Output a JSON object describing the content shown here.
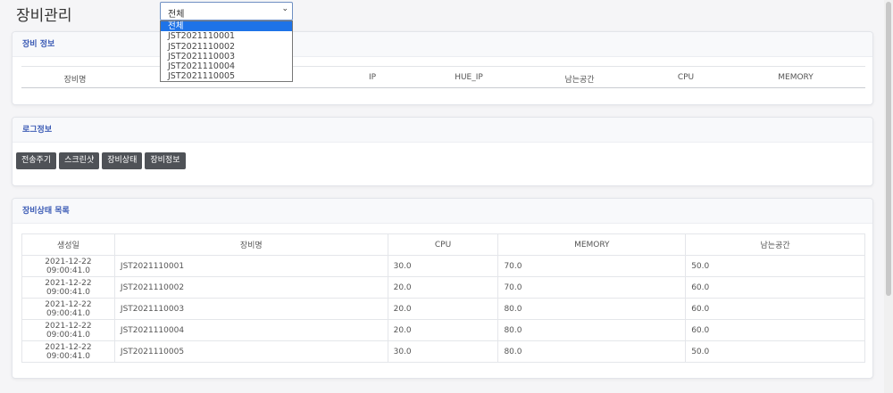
{
  "page": {
    "title": "장비관리"
  },
  "device_select": {
    "selected": "전체",
    "options": [
      "전체",
      "JST2021110001",
      "JST2021110002",
      "JST2021110003",
      "JST2021110004",
      "JST2021110005"
    ]
  },
  "device_info": {
    "title": "장비 정보",
    "columns": [
      "장비명",
      "IP",
      "HUE_IP",
      "남는공간",
      "CPU",
      "MEMORY"
    ]
  },
  "log_info": {
    "title": "로그정보",
    "buttons": [
      "전송주기",
      "스크린샷",
      "장비상태",
      "장비정보"
    ]
  },
  "status_list": {
    "title": "장비상태 목록",
    "columns": [
      "생성일",
      "장비명",
      "CPU",
      "MEMORY",
      "남는공간"
    ],
    "rows": [
      [
        "2021-12-22 09:00:41.0",
        "JST2021110001",
        "30.0",
        "70.0",
        "50.0"
      ],
      [
        "2021-12-22 09:00:41.0",
        "JST2021110002",
        "20.0",
        "70.0",
        "60.0"
      ],
      [
        "2021-12-22 09:00:41.0",
        "JST2021110003",
        "20.0",
        "80.0",
        "60.0"
      ],
      [
        "2021-12-22 09:00:41.0",
        "JST2021110004",
        "20.0",
        "80.0",
        "60.0"
      ],
      [
        "2021-12-22 09:00:41.0",
        "JST2021110005",
        "30.0",
        "80.0",
        "50.0"
      ]
    ]
  }
}
